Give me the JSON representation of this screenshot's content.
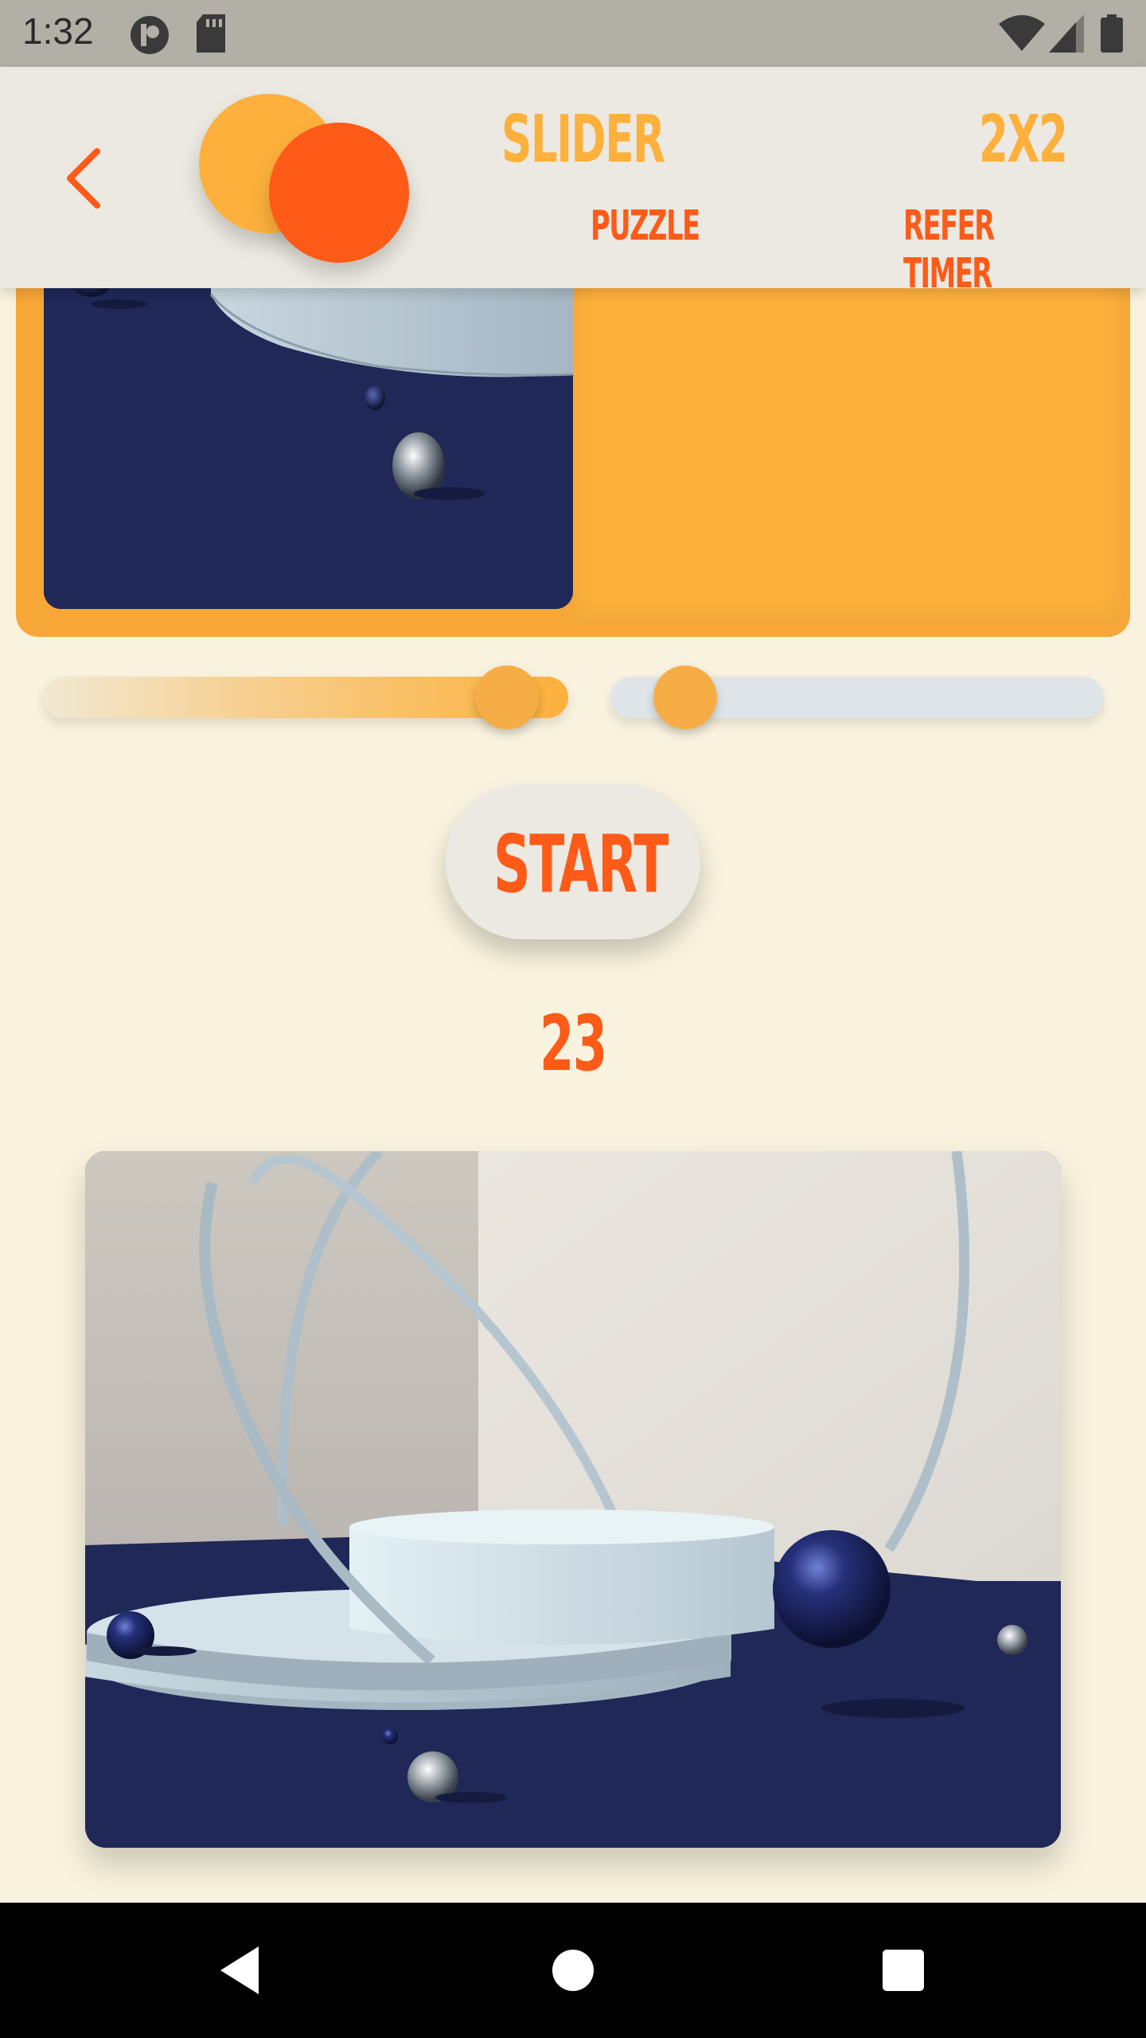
{
  "status_bar": {
    "time": "1:32"
  },
  "header": {
    "title": "SLIDER",
    "subtitle": "PUZZLE",
    "grid_size": "2X2",
    "refer_timer": "REFER TIMER"
  },
  "controls": {
    "left_slider_value": 0.93,
    "right_slider_value": 0.1,
    "start_label": "START",
    "counter": "23"
  },
  "colors": {
    "background": "#f8f2de",
    "accent_orange": "#fdb03c",
    "accent_red": "#fe5a18",
    "header_bg": "#ebe9e1",
    "navy": "#1f2857"
  },
  "icons": {
    "back": "chevron-left-icon",
    "nav_back": "triangle-back-icon",
    "nav_home": "circle-home-icon",
    "nav_recents": "square-recents-icon"
  }
}
